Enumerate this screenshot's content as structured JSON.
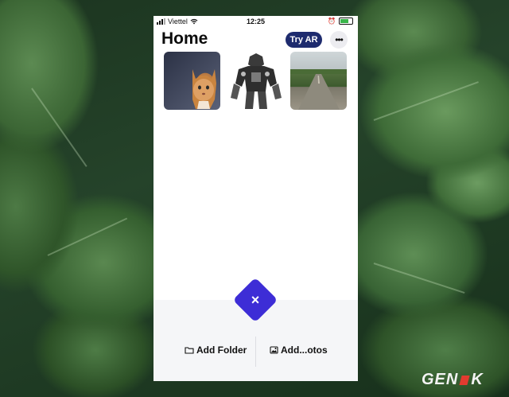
{
  "status_bar": {
    "carrier": "Viettel",
    "time": "12:25"
  },
  "header": {
    "title": "Home",
    "try_ar_label": "Try AR",
    "more_icon": "ellipsis-icon"
  },
  "gallery": {
    "items": [
      {
        "subject": "cat"
      },
      {
        "subject": "robot"
      },
      {
        "subject": "road"
      }
    ]
  },
  "fab": {
    "icon": "close-icon",
    "symbol": "×",
    "color": "#3d2dd6"
  },
  "actions": {
    "add_folder_label": "Add Folder",
    "add_photos_label": "Add...otos"
  },
  "watermark": {
    "brand": "GENK"
  },
  "colors": {
    "accent": "#3d2dd6",
    "try_ar_bg": "#1e2b6e"
  }
}
